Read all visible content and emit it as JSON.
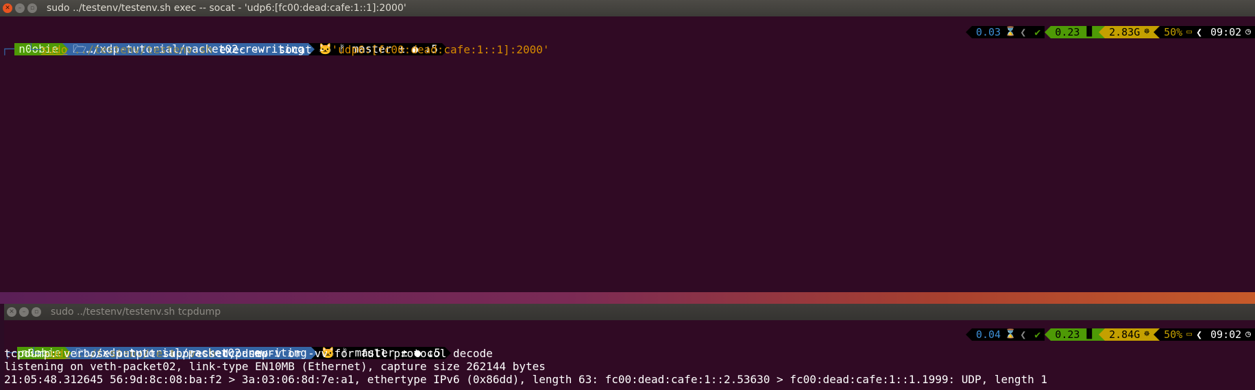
{
  "top_window": {
    "title": "sudo ../testenv/testenv.sh exec -- socat - 'udp6:[fc00:dead:cafe:1::1]:2000'",
    "prompt": {
      "user": "n0obie",
      "dir": "…/xdp-tutorial/packet02-rewriting",
      "git_icon": "github-cat-icon",
      "branch_symbol": "ᚠ",
      "branch": "master",
      "git_status": "± ● ↓5"
    },
    "command": {
      "sudo": "sudo",
      "path": "../testenv/testenv.sh",
      "args": " exec --  socat - ",
      "string": "'udp6:[fc00:dead:cafe:1::1]:2000'"
    },
    "status": {
      "load": "0.03",
      "load_icon": "⌛",
      "ok": "✔",
      "cpu": "0.23",
      "cpu_icon": "▐▌",
      "ram": "2.83G",
      "ram_icon": "☸",
      "disk": "50%",
      "disk_icon": "▭",
      "time": "09:02",
      "clock_icon": "◷"
    }
  },
  "bottom_window": {
    "title": "sudo ../testenv/testenv.sh tcpdump",
    "prompt": {
      "user": "n0obie",
      "dir": "…/xdp-tutorial/packet02-rewriting",
      "branch_symbol": "ᚠ",
      "branch": "master",
      "git_status": "± ● ↓5"
    },
    "command": {
      "sudo": "sudo",
      "path": "../testenv/testenv.sh",
      "args": " tcpdump"
    },
    "status": {
      "load": "0.04",
      "ok": "✔",
      "cpu": "0.23",
      "ram": "2.84G",
      "disk": "50%",
      "time": "09:02"
    },
    "output": [
      "tcpdump: verbose output suppressed, use -v or -vv for full protocol decode",
      "listening on veth-packet02, link-type EN10MB (Ethernet), capture size 262144 bytes",
      "21:05:48.312645 56:9d:8c:08:ba:f2 > 3a:03:06:8d:7e:a1, ethertype IPv6 (0x86dd), length 63: fc00:dead:cafe:1::2.53630 > fc00:dead:cafe:1::1.1999: UDP, length 1"
    ]
  }
}
